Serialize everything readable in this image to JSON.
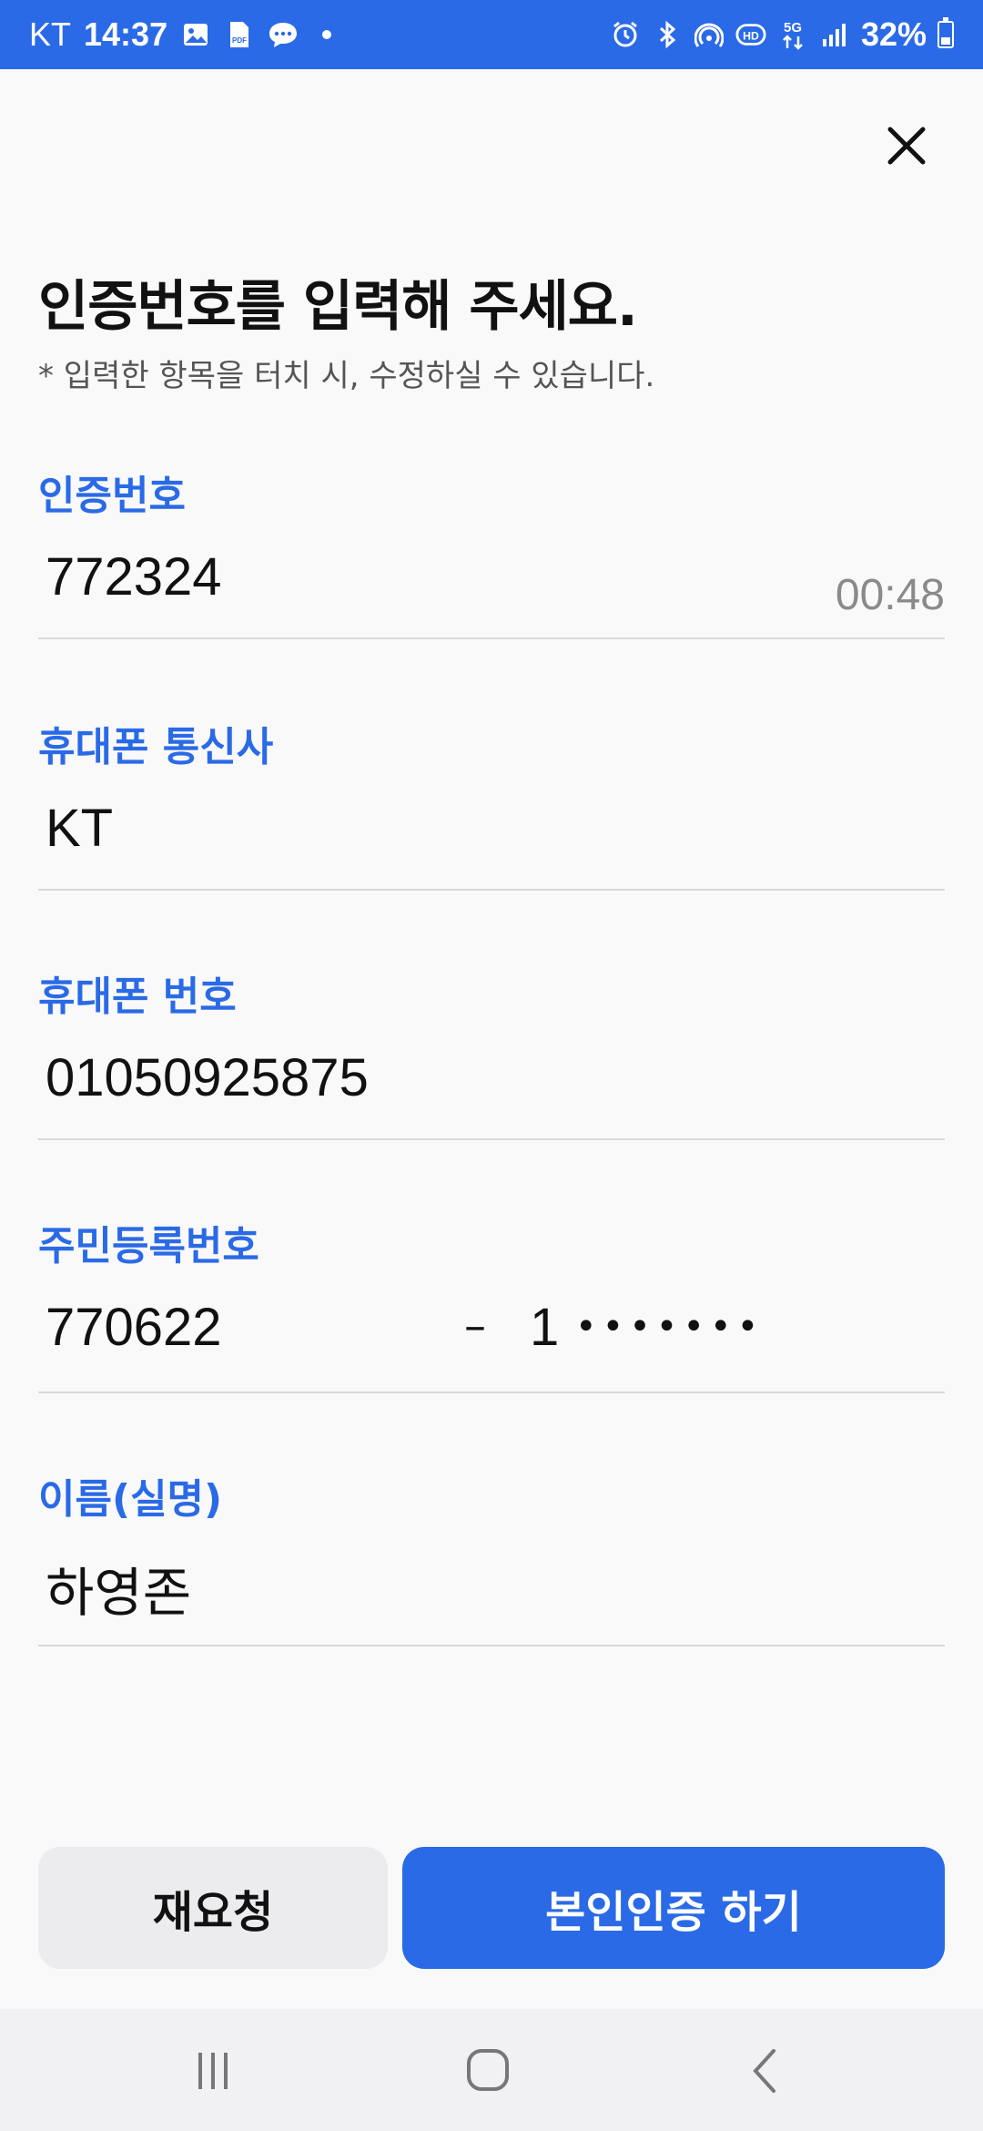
{
  "status_bar": {
    "carrier": "KT",
    "time": "14:37",
    "battery": "32%",
    "left_icons": [
      "image-icon",
      "pdf-icon",
      "chat-icon",
      "dot-icon"
    ],
    "right_icons": [
      "alarm-icon",
      "bluetooth-icon",
      "hotspot-icon",
      "hd-icon",
      "5g-icon",
      "signal-icon",
      "battery-icon"
    ],
    "pdf_text": "PDF",
    "hd_text": "HD",
    "fiveg_text": "5G"
  },
  "header": {
    "title": "인증번호를 입력해 주세요.",
    "subtitle": "* 입력한 항목을 터치 시, 수정하실 수 있습니다."
  },
  "fields": {
    "code": {
      "label": "인증번호",
      "value": "772324",
      "timer": "00:48"
    },
    "carrier": {
      "label": "휴대폰 통신사",
      "value": "KT"
    },
    "phone": {
      "label": "휴대폰 번호",
      "value": "01050925875"
    },
    "rrn": {
      "label": "주민등록번호",
      "front": "770622",
      "separator": "–",
      "back_first": "1",
      "masked": "•••••••"
    },
    "name": {
      "label": "이름(실명)",
      "value": "하영존"
    }
  },
  "buttons": {
    "retry": "재요청",
    "verify": "본인인증 하기"
  },
  "colors": {
    "accent": "#2a6ae6",
    "background": "#f9f9fa",
    "divider": "#d9d9dc",
    "secondary_button": "#ececee"
  },
  "nav_bar": {
    "icons": [
      "recent-apps-icon",
      "home-icon",
      "back-icon"
    ]
  }
}
